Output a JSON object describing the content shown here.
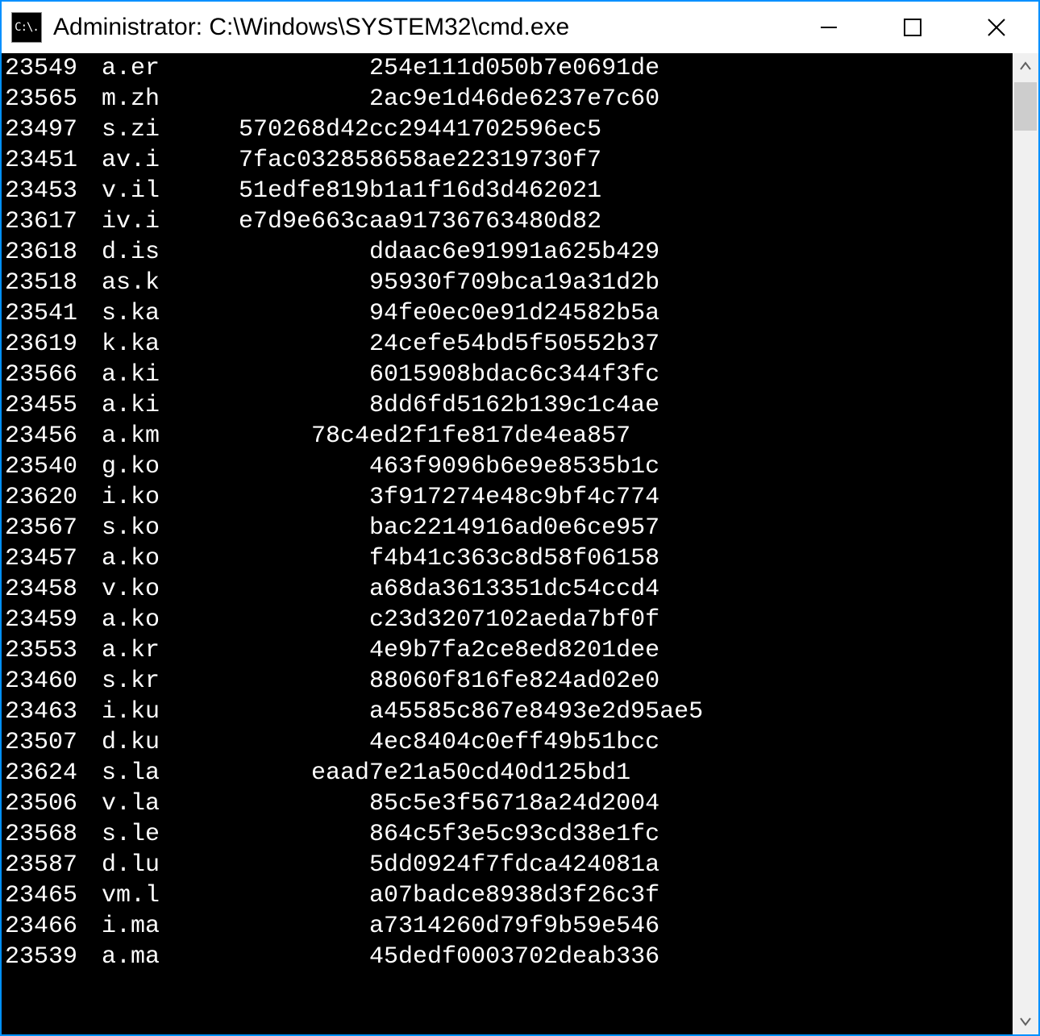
{
  "window": {
    "title": "Administrator: C:\\Windows\\SYSTEM32\\cmd.exe",
    "icon_text": "C:\\."
  },
  "rows": [
    {
      "id": "23549",
      "name": "a.er",
      "hash_visible": "254e111d050b7e0691de",
      "hash_indent": "wide"
    },
    {
      "id": "23565",
      "name": "m.zh",
      "hash_visible": "2ac9e1d46de6237e7c60",
      "hash_indent": "wide"
    },
    {
      "id": "23497",
      "name": "s.zi",
      "hash_visible": "570268d42cc29441702596ec5",
      "hash_indent": "short"
    },
    {
      "id": "23451",
      "name": "av.i",
      "hash_visible": "7fac032858658ae22319730f7",
      "hash_indent": "short"
    },
    {
      "id": "23453",
      "name": "v.il",
      "hash_visible": "51edfe819b1a1f16d3d462021",
      "hash_indent": "short"
    },
    {
      "id": "23617",
      "name": "iv.i",
      "hash_visible": "e7d9e663caa91736763480d82",
      "hash_indent": "short"
    },
    {
      "id": "23618",
      "name": "d.is",
      "hash_visible": "ddaac6e91991a625b429",
      "hash_indent": "wide"
    },
    {
      "id": "23518",
      "name": "as.k",
      "hash_visible": "95930f709bca19a31d2b",
      "hash_indent": "wide"
    },
    {
      "id": "23541",
      "name": "s.ka",
      "hash_visible": "94fe0ec0e91d24582b5a",
      "hash_indent": "wide"
    },
    {
      "id": "23619",
      "name": "k.ka",
      "hash_visible": "24cefe54bd5f50552b37",
      "hash_indent": "wide"
    },
    {
      "id": "23566",
      "name": "a.ki",
      "hash_visible": "6015908bdac6c344f3fc",
      "hash_indent": "wide"
    },
    {
      "id": "23455",
      "name": "a.ki",
      "hash_visible": "8dd6fd5162b139c1c4ae",
      "hash_indent": "wide"
    },
    {
      "id": "23456",
      "name": "a.km",
      "hash_visible": "78c4ed2f1fe817de4ea857",
      "hash_indent": "mid"
    },
    {
      "id": "23540",
      "name": "g.ko",
      "hash_visible": "463f9096b6e9e8535b1c",
      "hash_indent": "wide"
    },
    {
      "id": "23620",
      "name": "i.ko",
      "hash_visible": "3f917274e48c9bf4c774",
      "hash_indent": "wide"
    },
    {
      "id": "23567",
      "name": "s.ko",
      "hash_visible": "bac2214916ad0e6ce957",
      "hash_indent": "wide"
    },
    {
      "id": "23457",
      "name": "a.ko",
      "hash_visible": "f4b41c363c8d58f06158",
      "hash_indent": "wide"
    },
    {
      "id": "23458",
      "name": "v.ko",
      "hash_visible": "a68da3613351dc54ccd4",
      "hash_indent": "wide"
    },
    {
      "id": "23459",
      "name": "a.ko",
      "hash_visible": "c23d3207102aeda7bf0f",
      "hash_indent": "wide"
    },
    {
      "id": "23553",
      "name": "a.kr",
      "hash_visible": "4e9b7fa2ce8ed8201dee",
      "hash_indent": "wide"
    },
    {
      "id": "23460",
      "name": "s.kr",
      "hash_visible": "88060f816fe824ad02e0",
      "hash_indent": "wide"
    },
    {
      "id": "23463",
      "name": "i.ku",
      "hash_visible": "a45585c867e8493e2d95ae5",
      "hash_indent": "wide"
    },
    {
      "id": "23507",
      "name": "d.ku",
      "hash_visible": "4ec8404c0eff49b51bcc",
      "hash_indent": "wide"
    },
    {
      "id": "23624",
      "name": "s.la",
      "hash_visible": "eaad7e21a50cd40d125bd1",
      "hash_indent": "mid"
    },
    {
      "id": "23506",
      "name": "v.la",
      "hash_visible": "85c5e3f56718a24d2004",
      "hash_indent": "wide"
    },
    {
      "id": "23568",
      "name": "s.le",
      "hash_visible": "864c5f3e5c93cd38e1fc",
      "hash_indent": "wide"
    },
    {
      "id": "23587",
      "name": "d.lu",
      "hash_visible": "5dd0924f7fdca424081a",
      "hash_indent": "wide"
    },
    {
      "id": "23465",
      "name": "vm.l",
      "hash_visible": "a07badce8938d3f26c3f",
      "hash_indent": "wide"
    },
    {
      "id": "23466",
      "name": "i.ma",
      "hash_visible": "a7314260d79f9b59e546",
      "hash_indent": "wide"
    },
    {
      "id": "23539",
      "name": "a.ma",
      "hash_visible": "45dedf0003702deab336",
      "hash_indent": "wide"
    }
  ],
  "indent": {
    "wide": "              ",
    "mid": "          ",
    "short": "     "
  }
}
